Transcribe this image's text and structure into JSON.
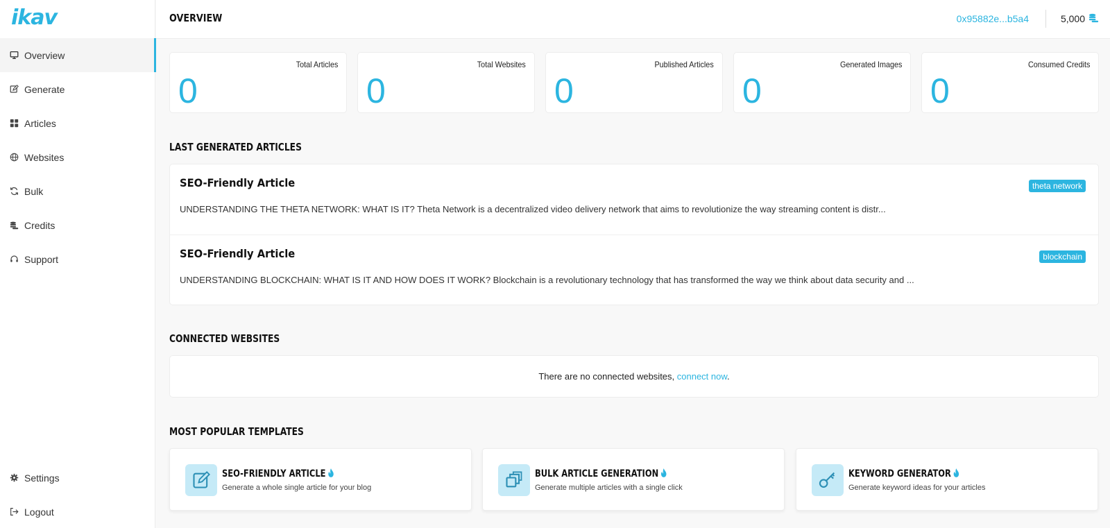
{
  "app": {
    "logo": "ikav",
    "accent": "#2cb5e0"
  },
  "sidebar": {
    "items": [
      {
        "label": "Overview",
        "icon": "monitor-icon",
        "active": true
      },
      {
        "label": "Generate",
        "icon": "edit-icon"
      },
      {
        "label": "Articles",
        "icon": "grid-icon"
      },
      {
        "label": "Websites",
        "icon": "globe-icon"
      },
      {
        "label": "Bulk",
        "icon": "refresh-icon"
      },
      {
        "label": "Credits",
        "icon": "coins-icon"
      },
      {
        "label": "Support",
        "icon": "headset-icon"
      }
    ],
    "bottom": [
      {
        "label": "Settings",
        "icon": "gear-icon"
      },
      {
        "label": "Logout",
        "icon": "logout-icon"
      }
    ]
  },
  "header": {
    "title": "OVERVIEW",
    "wallet": "0x95882e...b5a4",
    "credits": "5,000"
  },
  "stats": [
    {
      "label": "Total Articles",
      "value": "0"
    },
    {
      "label": "Total Websites",
      "value": "0"
    },
    {
      "label": "Published Articles",
      "value": "0"
    },
    {
      "label": "Generated Images",
      "value": "0"
    },
    {
      "label": "Consumed Credits",
      "value": "0"
    }
  ],
  "last_articles": {
    "title": "LAST GENERATED ARTICLES",
    "items": [
      {
        "title": "SEO-Friendly Article",
        "excerpt": "UNDERSTANDING THE THETA NETWORK: WHAT IS IT? Theta Network is a decentralized video delivery network that aims to revolutionize the way streaming content is distr...",
        "tag": "theta network"
      },
      {
        "title": "SEO-Friendly Article",
        "excerpt": "UNDERSTANDING BLOCKCHAIN: WHAT IS IT AND HOW DOES IT WORK? Blockchain is a revolutionary technology that has transformed the way we think about data security and ...",
        "tag": "blockchain"
      }
    ]
  },
  "connected_websites": {
    "title": "CONNECTED WEBSITES",
    "message": "There are no connected websites, ",
    "link": "connect now",
    "suffix": "."
  },
  "templates": {
    "title": "MOST POPULAR TEMPLATES",
    "items": [
      {
        "title": "SEO-FRIENDLY ARTICLE",
        "desc": "Generate a whole single article for your blog",
        "icon": "edit-icon"
      },
      {
        "title": "BULK ARTICLE GENERATION",
        "desc": "Generate multiple articles with a single click",
        "icon": "copy-icon"
      },
      {
        "title": "KEYWORD GENERATOR",
        "desc": "Generate keyword ideas for your articles",
        "icon": "key-icon"
      }
    ]
  }
}
